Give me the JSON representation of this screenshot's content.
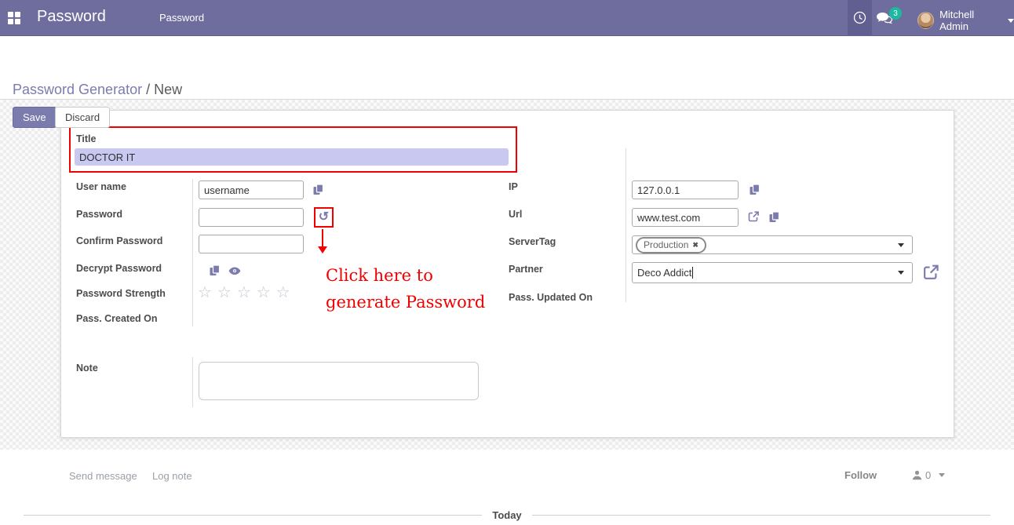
{
  "colors": {
    "navbar_bg": "#6f6d9e",
    "systray_bg": "#615e92",
    "badge_bg": "#1cb9a0",
    "accent_purple": "#7c7bad",
    "annotation_red": "#f20000",
    "title_highlight": "#c8c8f1"
  },
  "navbar": {
    "brand": "Password",
    "menu_item": "Password",
    "messages_count": "3",
    "user_name": "Mitchell Admin"
  },
  "breadcrumb": {
    "link": "Password Generator",
    "separator": "/",
    "current": "New"
  },
  "actions": {
    "save": "Save",
    "discard": "Discard"
  },
  "form": {
    "title_field": {
      "label": "Title",
      "value": "DOCTOR IT"
    },
    "user_name": {
      "label": "User name",
      "value": "username"
    },
    "password": {
      "label": "Password",
      "value": ""
    },
    "confirm_password": {
      "label": "Confirm Password",
      "value": ""
    },
    "decrypt_password": {
      "label": "Decrypt Password"
    },
    "password_strength": {
      "label": "Password Strength"
    },
    "pass_created_on": {
      "label": "Pass. Created On",
      "value": ""
    },
    "ip": {
      "label": "IP",
      "value": "127.0.0.1"
    },
    "url": {
      "label": "Url",
      "value": "www.test.com"
    },
    "server_tag": {
      "label": "ServerTag",
      "tag": "Production"
    },
    "partner": {
      "label": "Partner",
      "value": "Deco Addict"
    },
    "pass_updated_on": {
      "label": "Pass. Updated On",
      "value": ""
    },
    "note": {
      "label": "Note",
      "value": ""
    }
  },
  "annotation": {
    "line1": "Click here to",
    "line2": "generate Password"
  },
  "chatter": {
    "send_message": "Send message",
    "log_note": "Log note",
    "follow": "Follow",
    "followers_count": "0",
    "date_divider": "Today"
  },
  "icons": {
    "rotate_glyph": "↺",
    "stars": "☆☆☆☆☆",
    "tag_remove": "✖"
  }
}
